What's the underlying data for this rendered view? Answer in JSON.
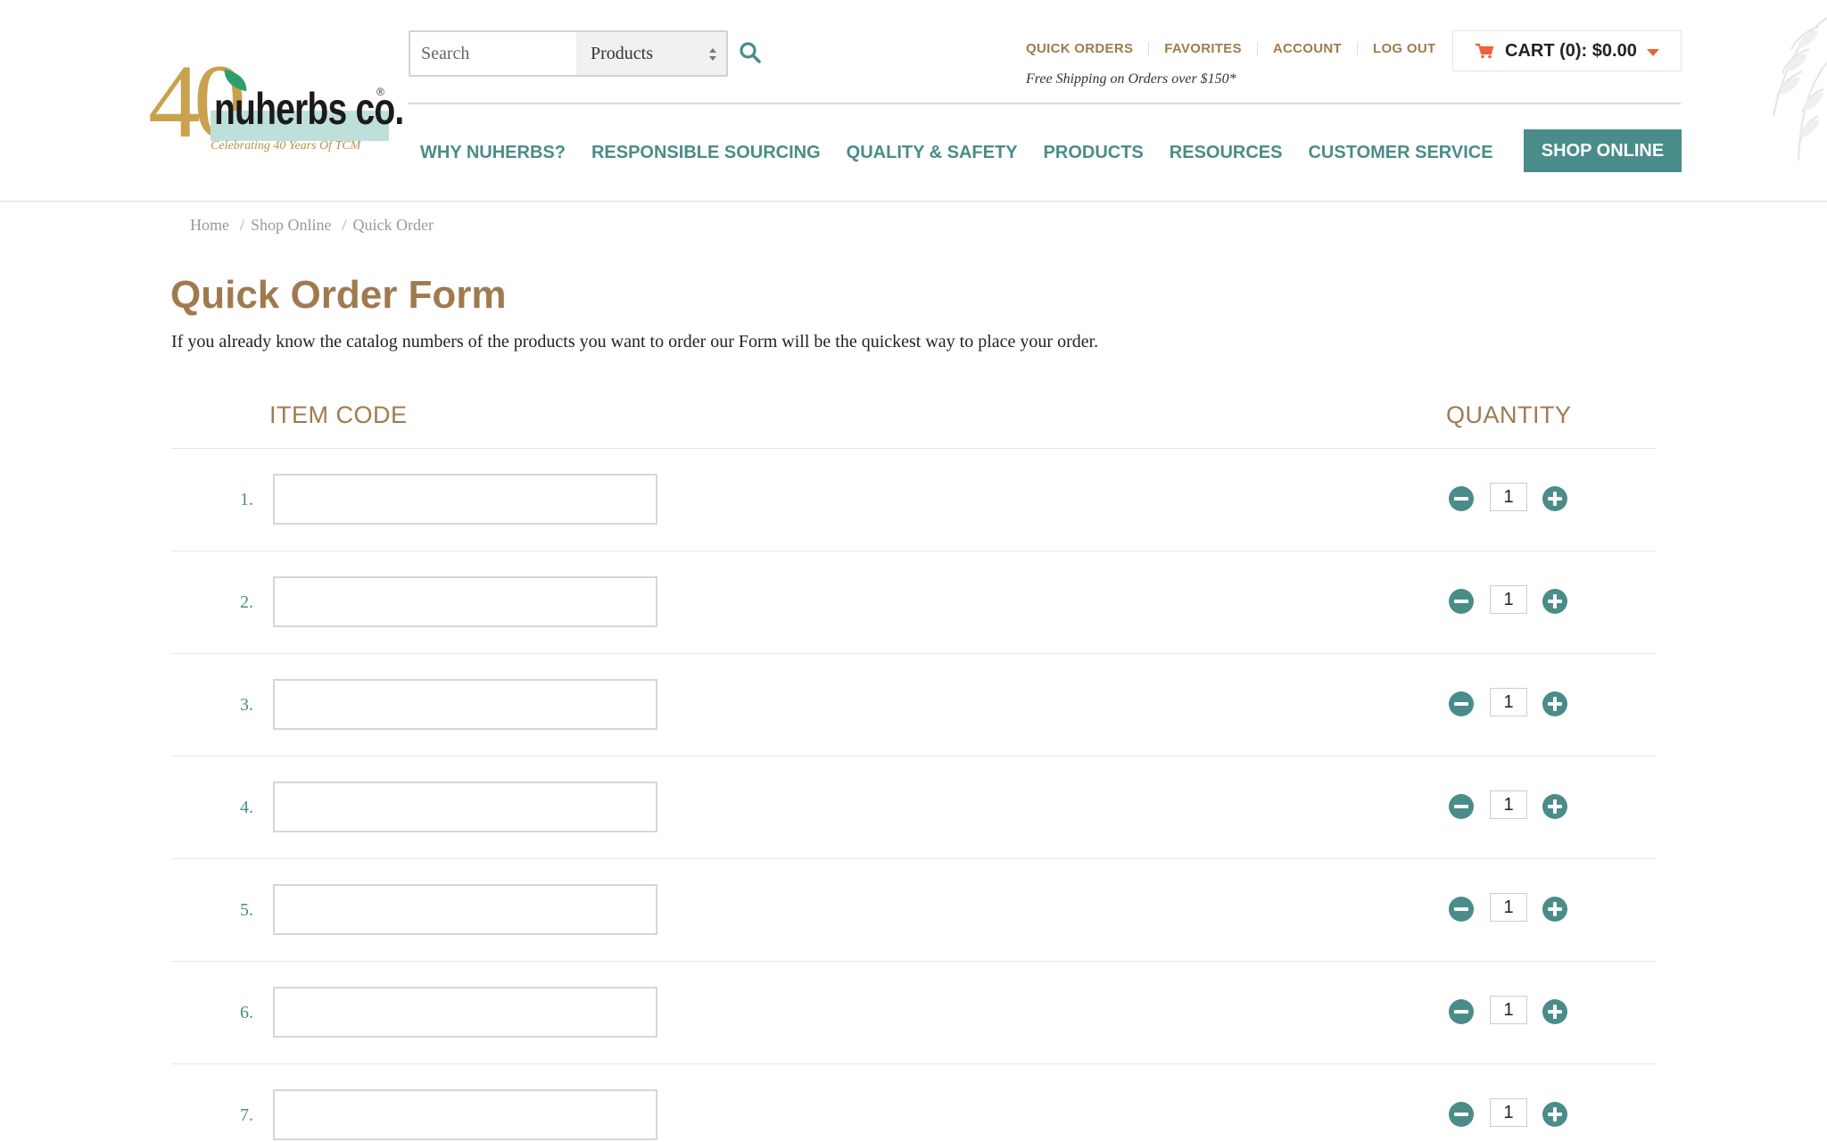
{
  "brand": {
    "logo_number": "40",
    "logo_name": "nuherbs co.",
    "logo_registered": "®",
    "tagline": "Celebrating 40 Years Of TCM"
  },
  "search": {
    "placeholder": "Search",
    "value": "",
    "category": "Products",
    "button_icon": "search-icon"
  },
  "utility": {
    "links": [
      "QUICK ORDERS",
      "FAVORITES",
      "ACCOUNT",
      "LOG OUT"
    ],
    "free_shipping": "Free Shipping on Orders over $150*"
  },
  "cart": {
    "label": "CART (0): $0.00",
    "icon": "shopping-cart-icon"
  },
  "nav": {
    "items": [
      "WHY NUHERBS?",
      "RESPONSIBLE SOURCING",
      "QUALITY & SAFETY",
      "PRODUCTS",
      "RESOURCES",
      "CUSTOMER SERVICE"
    ],
    "cta": "SHOP ONLINE"
  },
  "breadcrumb": [
    "Home",
    "Shop Online",
    "Quick Order"
  ],
  "page": {
    "title": "Quick Order Form",
    "intro": "If you already know the catalog numbers of the products you want to order our Form will be the quickest way to place your order."
  },
  "form": {
    "columns": {
      "item_code": "ITEM CODE",
      "quantity": "QUANTITY"
    },
    "rows": [
      {
        "number": "1.",
        "item_code": "",
        "quantity": "1"
      },
      {
        "number": "2.",
        "item_code": "",
        "quantity": "1"
      },
      {
        "number": "3.",
        "item_code": "",
        "quantity": "1"
      },
      {
        "number": "4.",
        "item_code": "",
        "quantity": "1"
      },
      {
        "number": "5.",
        "item_code": "",
        "quantity": "1"
      },
      {
        "number": "6.",
        "item_code": "",
        "quantity": "1"
      },
      {
        "number": "7.",
        "item_code": "",
        "quantity": "1"
      }
    ]
  },
  "colors": {
    "brand_teal": "#4a8c89",
    "brand_brown": "#a07a4f",
    "cart_accent": "#e8643a",
    "logo_gold": "#c9a24f"
  }
}
